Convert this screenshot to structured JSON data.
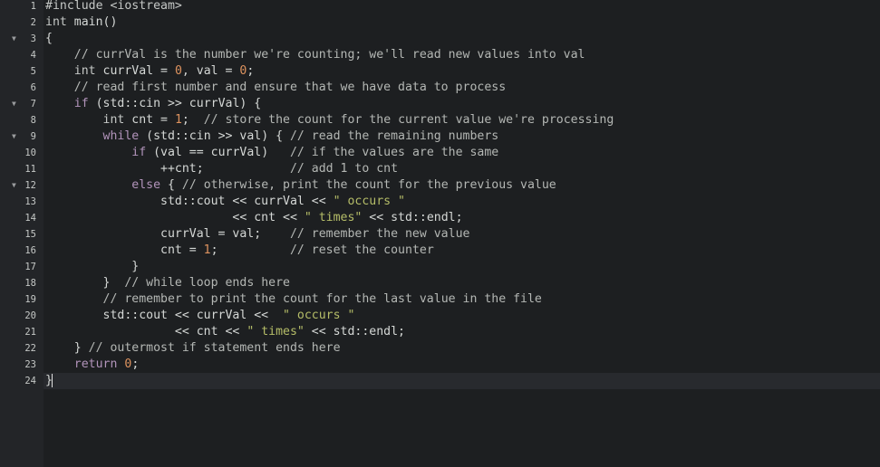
{
  "theme": {
    "background": "#1d1f21",
    "gutter": "#232528",
    "text": "#d5d8d6",
    "keyword": "#b294bb",
    "comment": "#b4b7b4",
    "string": "#b5bd68",
    "number": "#de935f"
  },
  "editor": {
    "active_line": 24,
    "fold_icon": "triangle-down-icon",
    "lines": [
      {
        "num": "1",
        "fold": false,
        "tokens": [
          [
            "pre",
            "#include <iostream>"
          ]
        ]
      },
      {
        "num": "2",
        "fold": false,
        "tokens": [
          [
            "ty",
            "int"
          ],
          [
            "txt",
            " main()"
          ]
        ]
      },
      {
        "num": "3",
        "fold": true,
        "tokens": [
          [
            "txt",
            "{"
          ]
        ]
      },
      {
        "num": "4",
        "fold": false,
        "tokens": [
          [
            "txt",
            "    "
          ],
          [
            "cm",
            "// currVal is the number we're counting; we'll read new values into val"
          ]
        ]
      },
      {
        "num": "5",
        "fold": false,
        "tokens": [
          [
            "txt",
            "    "
          ],
          [
            "ty",
            "int"
          ],
          [
            "txt",
            " currVal = "
          ],
          [
            "nm",
            "0"
          ],
          [
            "txt",
            ", val = "
          ],
          [
            "nm",
            "0"
          ],
          [
            "txt",
            ";"
          ]
        ]
      },
      {
        "num": "6",
        "fold": false,
        "tokens": [
          [
            "txt",
            "    "
          ],
          [
            "cm",
            "// read first number and ensure that we have data to process"
          ]
        ]
      },
      {
        "num": "7",
        "fold": true,
        "tokens": [
          [
            "txt",
            "    "
          ],
          [
            "kw",
            "if"
          ],
          [
            "txt",
            " (std::cin >> currVal) {"
          ]
        ]
      },
      {
        "num": "8",
        "fold": false,
        "tokens": [
          [
            "txt",
            "        "
          ],
          [
            "ty",
            "int"
          ],
          [
            "txt",
            " cnt = "
          ],
          [
            "nm",
            "1"
          ],
          [
            "txt",
            ";  "
          ],
          [
            "cm",
            "// store the count for the current value we're processing"
          ]
        ]
      },
      {
        "num": "9",
        "fold": true,
        "tokens": [
          [
            "txt",
            "        "
          ],
          [
            "kw",
            "while"
          ],
          [
            "txt",
            " (std::cin >> val) { "
          ],
          [
            "cm",
            "// read the remaining numbers"
          ]
        ]
      },
      {
        "num": "10",
        "fold": false,
        "tokens": [
          [
            "txt",
            "            "
          ],
          [
            "kw",
            "if"
          ],
          [
            "txt",
            " (val == currVal)   "
          ],
          [
            "cm",
            "// if the values are the same"
          ]
        ]
      },
      {
        "num": "11",
        "fold": false,
        "tokens": [
          [
            "txt",
            "                ++cnt;            "
          ],
          [
            "cm",
            "// add 1 to cnt"
          ]
        ]
      },
      {
        "num": "12",
        "fold": true,
        "tokens": [
          [
            "txt",
            "            "
          ],
          [
            "kw",
            "else"
          ],
          [
            "txt",
            " { "
          ],
          [
            "cm",
            "// otherwise, print the count for the previous value"
          ]
        ]
      },
      {
        "num": "13",
        "fold": false,
        "tokens": [
          [
            "txt",
            "                std::cout << currVal << "
          ],
          [
            "st",
            "\" occurs \""
          ]
        ]
      },
      {
        "num": "14",
        "fold": false,
        "tokens": [
          [
            "txt",
            "                          << cnt << "
          ],
          [
            "st",
            "\" times\""
          ],
          [
            "txt",
            " << std::endl;"
          ]
        ]
      },
      {
        "num": "15",
        "fold": false,
        "tokens": [
          [
            "txt",
            "                currVal = val;    "
          ],
          [
            "cm",
            "// remember the new value"
          ]
        ]
      },
      {
        "num": "16",
        "fold": false,
        "tokens": [
          [
            "txt",
            "                cnt = "
          ],
          [
            "nm",
            "1"
          ],
          [
            "txt",
            ";          "
          ],
          [
            "cm",
            "// reset the counter"
          ]
        ]
      },
      {
        "num": "17",
        "fold": false,
        "tokens": [
          [
            "txt",
            "            }"
          ]
        ]
      },
      {
        "num": "18",
        "fold": false,
        "tokens": [
          [
            "txt",
            "        }  "
          ],
          [
            "cm",
            "// while loop ends here"
          ]
        ]
      },
      {
        "num": "19",
        "fold": false,
        "tokens": [
          [
            "txt",
            "        "
          ],
          [
            "cm",
            "// remember to print the count for the last value in the file"
          ]
        ]
      },
      {
        "num": "20",
        "fold": false,
        "tokens": [
          [
            "txt",
            "        std::cout << currVal <<  "
          ],
          [
            "st",
            "\" occurs \""
          ]
        ]
      },
      {
        "num": "21",
        "fold": false,
        "tokens": [
          [
            "txt",
            "                  << cnt << "
          ],
          [
            "st",
            "\" times\""
          ],
          [
            "txt",
            " << std::endl;"
          ]
        ]
      },
      {
        "num": "22",
        "fold": false,
        "tokens": [
          [
            "txt",
            "    } "
          ],
          [
            "cm",
            "// outermost if statement ends here"
          ]
        ]
      },
      {
        "num": "23",
        "fold": false,
        "tokens": [
          [
            "txt",
            "    "
          ],
          [
            "kw",
            "return"
          ],
          [
            "txt",
            " "
          ],
          [
            "nm",
            "0"
          ],
          [
            "txt",
            ";"
          ]
        ]
      },
      {
        "num": "24",
        "fold": false,
        "tokens": [
          [
            "txt",
            "}"
          ]
        ]
      }
    ]
  }
}
